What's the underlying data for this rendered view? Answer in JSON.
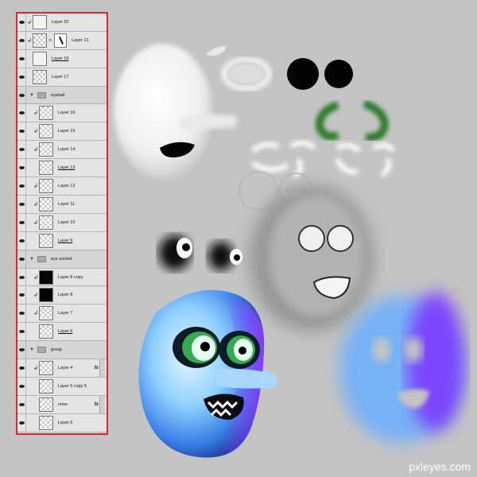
{
  "watermark": "pxleyes.com",
  "layers": [
    {
      "name": "Layer 20",
      "kind": "layer",
      "clip": true,
      "thumb": "face",
      "underline": false
    },
    {
      "name": "Layer 21",
      "kind": "layer",
      "clip": true,
      "thumb": "checker",
      "mask": true,
      "underline": false
    },
    {
      "name": "Layer 19",
      "kind": "layer",
      "clip": false,
      "thumb": "face",
      "underline": true
    },
    {
      "name": "Layer 17",
      "kind": "layer",
      "clip": false,
      "thumb": "checker",
      "underline": false
    },
    {
      "name": "eyeball",
      "kind": "group"
    },
    {
      "name": "Layer 16",
      "kind": "layer",
      "clip": true,
      "indent": true,
      "thumb": "checker",
      "underline": false
    },
    {
      "name": "Layer 15",
      "kind": "layer",
      "clip": true,
      "indent": true,
      "thumb": "checker",
      "underline": false
    },
    {
      "name": "Layer 14",
      "kind": "layer",
      "clip": true,
      "indent": true,
      "thumb": "checker",
      "underline": false
    },
    {
      "name": "Layer 13",
      "kind": "layer",
      "clip": false,
      "indent": true,
      "thumb": "checker",
      "underline": true
    },
    {
      "name": "Layer 12",
      "kind": "layer",
      "clip": true,
      "indent": true,
      "thumb": "checker",
      "underline": false
    },
    {
      "name": "Layer 11",
      "kind": "layer",
      "clip": true,
      "indent": true,
      "thumb": "checker",
      "underline": false
    },
    {
      "name": "Layer 10",
      "kind": "layer",
      "clip": true,
      "indent": true,
      "thumb": "checker",
      "underline": false
    },
    {
      "name": "Layer 9",
      "kind": "layer",
      "clip": false,
      "indent": true,
      "thumb": "checker",
      "underline": true
    },
    {
      "name": "eye socket",
      "kind": "group"
    },
    {
      "name": "Layer 8 copy",
      "kind": "layer",
      "clip": true,
      "indent": true,
      "thumb": "dark",
      "underline": false
    },
    {
      "name": "Layer 8",
      "kind": "layer",
      "clip": true,
      "indent": true,
      "thumb": "dark",
      "underline": false
    },
    {
      "name": "Layer 7",
      "kind": "layer",
      "clip": true,
      "indent": true,
      "thumb": "checker",
      "underline": false
    },
    {
      "name": "Layer 6",
      "kind": "layer",
      "clip": false,
      "indent": true,
      "thumb": "checker",
      "underline": true
    },
    {
      "name": "group",
      "kind": "group"
    },
    {
      "name": "Layer 4",
      "kind": "layer",
      "clip": true,
      "indent": true,
      "thumb": "checker",
      "fx": "fx",
      "underline": false
    },
    {
      "name": "Layer 5 copy 5",
      "kind": "layer",
      "clip": false,
      "indent": true,
      "thumb": "checker",
      "underline": false
    },
    {
      "name": "nose",
      "kind": "layer",
      "clip": false,
      "indent": true,
      "thumb": "checker",
      "fx": "fx",
      "underline": false
    },
    {
      "name": "Layer 5",
      "kind": "layer",
      "clip": false,
      "indent": true,
      "thumb": "checker",
      "underline": false
    },
    {
      "name": "Layer 2",
      "kind": "layer",
      "clip": false,
      "indent": true,
      "thumb": "face",
      "fx": "fx",
      "underline": false
    }
  ]
}
